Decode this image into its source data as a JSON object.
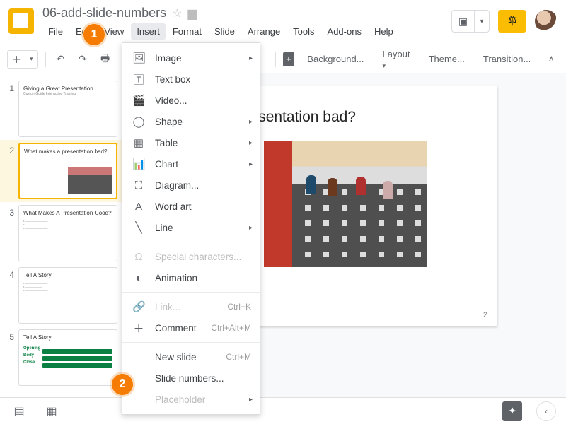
{
  "doc_title": "06-add-slide-numbers",
  "menubar": [
    "File",
    "Edit",
    "View",
    "Insert",
    "Format",
    "Slide",
    "Arrange",
    "Tools",
    "Add-ons",
    "Help"
  ],
  "menubar_active_index": 3,
  "toolbar": {
    "background": "Background...",
    "layout": "Layout",
    "theme": "Theme...",
    "transition": "Transition..."
  },
  "thumbs": [
    {
      "num": "1",
      "title": "Giving a Great Presentation",
      "sub": "CustomGuide Interactive Training",
      "active": false
    },
    {
      "num": "2",
      "title": "What makes a presentation bad?",
      "sub": "",
      "active": true,
      "img": true
    },
    {
      "num": "3",
      "title": "What Makes A Presentation Good?",
      "sub": "",
      "active": false,
      "bullets": true
    },
    {
      "num": "4",
      "title": "Tell A Story",
      "sub": "",
      "active": false,
      "bullets": true
    },
    {
      "num": "5",
      "title": "Tell A Story",
      "sub": "",
      "active": false,
      "bars": [
        "Opening",
        "Body",
        "Close"
      ]
    }
  ],
  "slide": {
    "title_fragment": "s a presentation bad?",
    "number": "2"
  },
  "insert_menu": [
    {
      "icon": "image",
      "label": "Image",
      "arrow": true
    },
    {
      "icon": "textbox",
      "label": "Text box"
    },
    {
      "icon": "video",
      "label": "Video..."
    },
    {
      "icon": "shape",
      "label": "Shape",
      "arrow": true
    },
    {
      "icon": "table",
      "label": "Table",
      "arrow": true
    },
    {
      "icon": "chart",
      "label": "Chart",
      "arrow": true
    },
    {
      "icon": "diagram",
      "label": "Diagram..."
    },
    {
      "icon": "wordart",
      "label": "Word art"
    },
    {
      "icon": "line",
      "label": "Line",
      "arrow": true
    },
    {
      "sep": true
    },
    {
      "icon": "omega",
      "label": "Special characters...",
      "disabled": true
    },
    {
      "icon": "anim",
      "label": "Animation"
    },
    {
      "sep": true
    },
    {
      "icon": "link",
      "label": "Link...",
      "shortcut": "Ctrl+K",
      "disabled": true
    },
    {
      "icon": "comment",
      "label": "Comment",
      "shortcut": "Ctrl+Alt+M"
    },
    {
      "sep": true
    },
    {
      "icon": "",
      "label": "New slide",
      "shortcut": "Ctrl+M"
    },
    {
      "icon": "",
      "label": "Slide numbers..."
    },
    {
      "icon": "",
      "label": "Placeholder",
      "arrow": true,
      "disabled": true
    }
  ],
  "badges": {
    "1": "1",
    "2": "2"
  }
}
